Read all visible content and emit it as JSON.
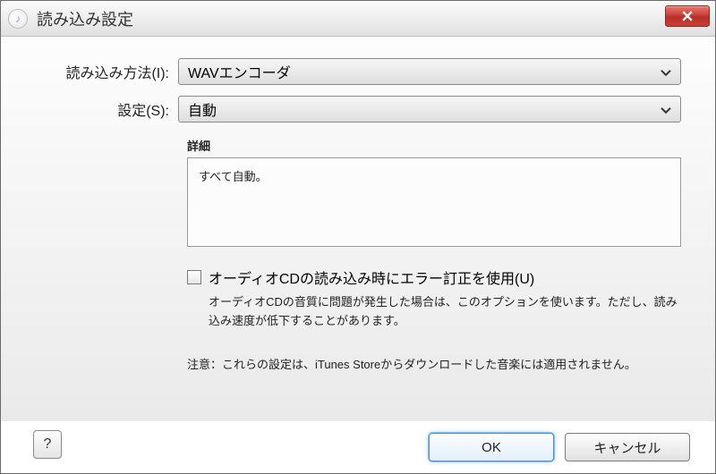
{
  "window": {
    "title": "読み込み設定"
  },
  "form": {
    "import_using_label": "読み込み方法(I):",
    "import_using_value": "WAVエンコーダ",
    "setting_label": "設定(S):",
    "setting_value": "自動"
  },
  "details": {
    "heading": "詳細",
    "body": "すべて自動。"
  },
  "error_correction": {
    "label": "オーディオCDの読み込み時にエラー訂正を使用(U)",
    "help": "オーディオCDの音質に問題が発生した場合は、このオプションを使います。ただし、読み込み速度が低下することがあります。"
  },
  "note": "注意：これらの設定は、iTunes Storeからダウンロードした音楽には適用されません。",
  "buttons": {
    "help": "?",
    "ok": "OK",
    "cancel": "キャンセル"
  }
}
